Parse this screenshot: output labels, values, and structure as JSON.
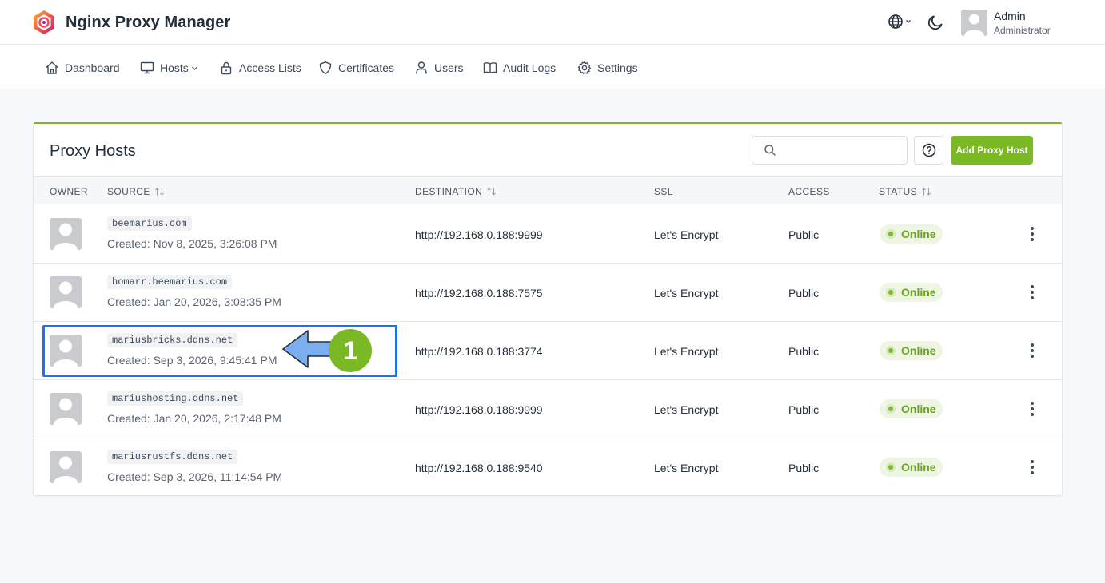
{
  "app": {
    "title": "Nginx Proxy Manager"
  },
  "user": {
    "name": "Admin",
    "role": "Administrator"
  },
  "nav": {
    "items": [
      {
        "label": "Dashboard",
        "icon": "home-icon"
      },
      {
        "label": "Hosts",
        "icon": "monitor-icon",
        "dropdown": true
      },
      {
        "label": "Access Lists",
        "icon": "lock-icon"
      },
      {
        "label": "Certificates",
        "icon": "shield-icon"
      },
      {
        "label": "Users",
        "icon": "user-icon"
      },
      {
        "label": "Audit Logs",
        "icon": "book-icon"
      },
      {
        "label": "Settings",
        "icon": "gear-icon"
      }
    ]
  },
  "card": {
    "title": "Proxy Hosts",
    "search_value": "",
    "add_button": "Add Proxy Host"
  },
  "table": {
    "headers": {
      "owner": "OWNER",
      "source": "SOURCE",
      "destination": "DESTINATION",
      "ssl": "SSL",
      "access": "ACCESS",
      "status": "STATUS"
    },
    "rows": [
      {
        "domain": "beemarius.com",
        "created": "Created: Nov 8, 2025, 3:26:08 PM",
        "destination": "http://192.168.0.188:9999",
        "ssl": "Let's Encrypt",
        "access": "Public",
        "status": "Online"
      },
      {
        "domain": "homarr.beemarius.com",
        "created": "Created: Jan 20, 2026, 3:08:35 PM",
        "destination": "http://192.168.0.188:7575",
        "ssl": "Let's Encrypt",
        "access": "Public",
        "status": "Online"
      },
      {
        "domain": "mariusbricks.ddns.net",
        "created": "Created: Sep 3, 2026, 9:45:41 PM",
        "destination": "http://192.168.0.188:3774",
        "ssl": "Let's Encrypt",
        "access": "Public",
        "status": "Online"
      },
      {
        "domain": "mariushosting.ddns.net",
        "created": "Created: Jan 20, 2026, 2:17:48 PM",
        "destination": "http://192.168.0.188:9999",
        "ssl": "Let's Encrypt",
        "access": "Public",
        "status": "Online"
      },
      {
        "domain": "mariusrustfs.ddns.net",
        "created": "Created: Sep 3, 2026, 11:14:54 PM",
        "destination": "http://192.168.0.188:9540",
        "ssl": "Let's Encrypt",
        "access": "Public",
        "status": "Online"
      }
    ]
  },
  "annotation": {
    "step_number": "1"
  },
  "colors": {
    "accent": "#7bb826",
    "highlight": "#1a73e8",
    "arrow": "#7aaef0"
  }
}
